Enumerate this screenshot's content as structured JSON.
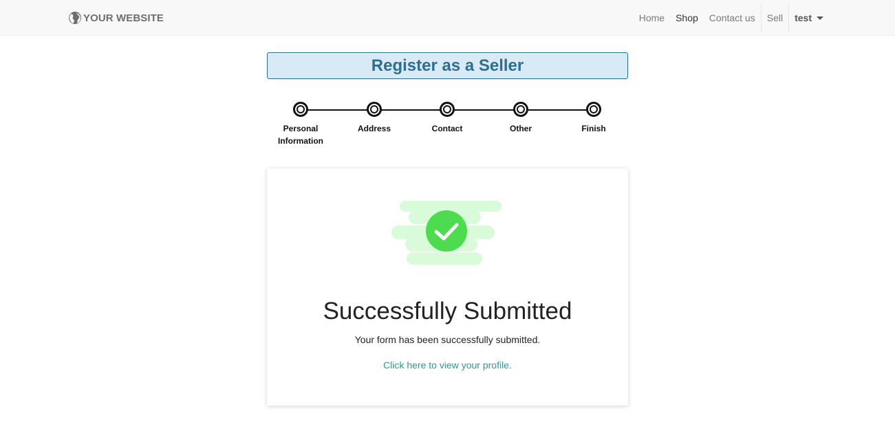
{
  "navbar": {
    "brand": "YOUR WEBSITE",
    "brand_icon": "globe-icon",
    "links": [
      {
        "label": "Home",
        "active": false
      },
      {
        "label": "Shop",
        "active": true
      },
      {
        "label": "Contact us",
        "active": false
      },
      {
        "label": "Sell",
        "active": false
      }
    ],
    "user": "test",
    "user_icon": "chevron-down-icon"
  },
  "page": {
    "title": "Register as a Seller",
    "title_color": "#2f6d91",
    "title_bg": "#d8eaf5"
  },
  "stepper": {
    "steps": [
      {
        "label": "Personal Information"
      },
      {
        "label": "Address"
      },
      {
        "label": "Contact"
      },
      {
        "label": "Other"
      },
      {
        "label": "Finish"
      }
    ]
  },
  "result": {
    "icon": "check-circle-icon",
    "accent": "#4cd964",
    "heading": "Successfully Submitted",
    "message": "Your form has been successfully submitted.",
    "link_text": "Click here to view your profile.",
    "link_color": "#2a9a98"
  }
}
